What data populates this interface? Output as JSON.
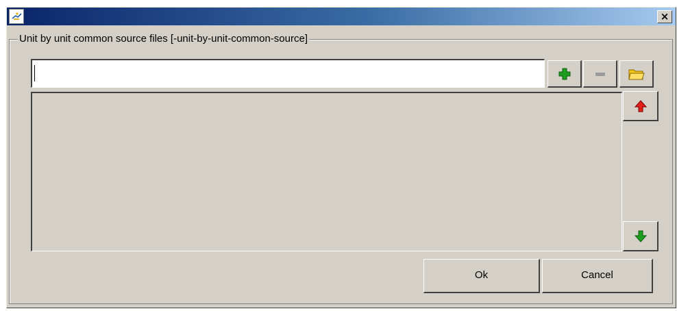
{
  "window": {
    "close_label": "×",
    "group_title": "Unit by unit common source files [-unit-by-unit-common-source]"
  },
  "entry": {
    "value": "",
    "placeholder": ""
  },
  "toolbar": {
    "add_icon": "plus-icon",
    "remove_icon": "minus-icon",
    "browse_icon": "folder-icon"
  },
  "list": {
    "items": [],
    "move_up_icon": "arrow-up-icon",
    "move_down_icon": "arrow-down-icon"
  },
  "buttons": {
    "ok_label": "Ok",
    "cancel_label": "Cancel"
  },
  "colors": {
    "titlebar_start": "#0a246a",
    "titlebar_end": "#a6caf0",
    "face": "#d4d0c8",
    "add_green": "#1e9e1e",
    "up_red": "#e0201b",
    "down_green": "#1e9e1e",
    "folder_yellow": "#f5c518"
  }
}
